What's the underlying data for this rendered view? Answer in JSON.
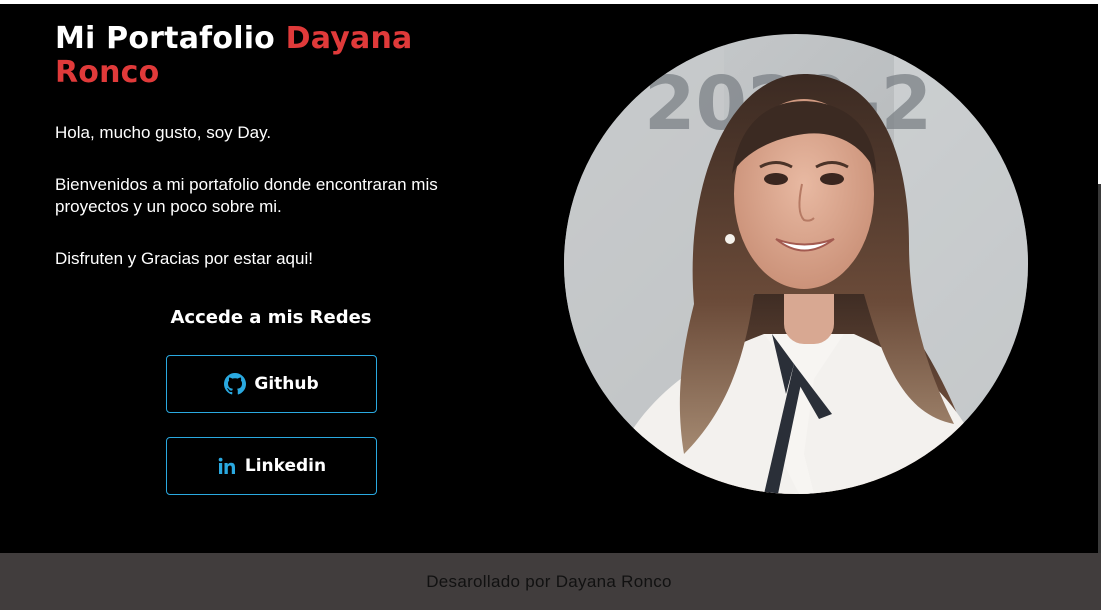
{
  "header": {
    "title_prefix": "Mi Portafolio",
    "title_name_first": "Dayana",
    "title_name_last": "Ronco",
    "accent_color": "#e03a3a"
  },
  "intro": {
    "greeting": "Hola, mucho gusto, soy Day.",
    "welcome": "Bienvenidos a mi portafolio donde encontraran mis proyectos y un poco sobre mi.",
    "thanks": "Disfruten y Gracias por estar aqui!"
  },
  "social": {
    "heading": "Accede a mis Redes",
    "border_color": "#2aa9e0",
    "links": [
      {
        "label": "Github",
        "icon": "github-icon"
      },
      {
        "label": "Linkedin",
        "icon": "linkedin-icon"
      }
    ]
  },
  "profile_photo": {
    "background_text": "2020-2"
  },
  "footer": {
    "text": "Desarollado por Dayana Ronco",
    "background_color": "#413d3d"
  }
}
